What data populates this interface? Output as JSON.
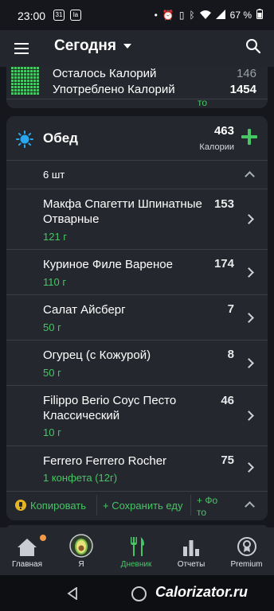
{
  "status_bar": {
    "time": "23:00",
    "calendar_day": "31",
    "app_badge": "la",
    "battery": "67 %"
  },
  "app_bar": {
    "title": "Сегодня"
  },
  "summary": {
    "remaining_label": "Осталось Калорий",
    "remaining_value": "146",
    "consumed_label": "Употреблено Калорий",
    "consumed_value": "1454",
    "partial_text": "то"
  },
  "meal": {
    "name": "Обед",
    "calories": "463",
    "calories_label": "Калории",
    "count": "6 шт",
    "items": [
      {
        "name": "Макфа Спагетти Шпинатные Отварные",
        "kcal": "153",
        "qty": "121 г"
      },
      {
        "name": "Куриное Филе Вареное",
        "kcal": "174",
        "qty": "110 г"
      },
      {
        "name": "Салат Айсберг",
        "kcal": "7",
        "qty": "50 г"
      },
      {
        "name": "Огурец (с Кожурой)",
        "kcal": "8",
        "qty": "50 г"
      },
      {
        "name": "Filippo Berio Соус Песто Классический",
        "kcal": "46",
        "qty": "10 г"
      },
      {
        "name": "Ferrero Ferrero Rocher",
        "kcal": "75",
        "qty": "1 конфета (12г)"
      }
    ],
    "actions": {
      "copy": "Копировать",
      "save": "+ Сохранить еду",
      "photo": "+ Фо то"
    }
  },
  "bottom_nav": [
    {
      "label": "Главная",
      "icon": "home-icon"
    },
    {
      "label": "Я",
      "icon": "avocado-icon"
    },
    {
      "label": "Дневник",
      "icon": "fork-knife-icon"
    },
    {
      "label": "Отчеты",
      "icon": "bar-chart-icon"
    },
    {
      "label": "Premium",
      "icon": "premium-icon"
    }
  ],
  "watermark": "Calorizator.ru",
  "colors": {
    "accent_green": "#46c665",
    "sun_blue": "#29a8f0",
    "notification_orange": "#f2994a",
    "copy_yellow": "#e6b422"
  }
}
